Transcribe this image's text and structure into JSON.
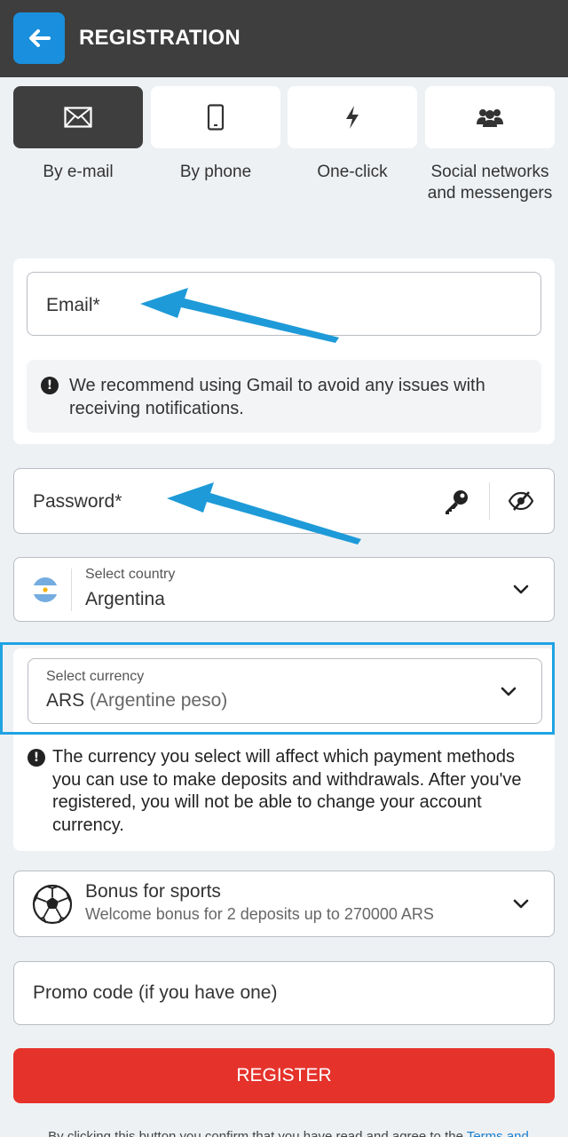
{
  "header": {
    "title": "REGISTRATION",
    "back_icon": "arrow-left-icon"
  },
  "tabs": [
    {
      "label": "By e-mail",
      "icon": "envelope-icon",
      "active": true
    },
    {
      "label": "By phone",
      "icon": "phone-icon",
      "active": false
    },
    {
      "label": "One-click",
      "icon": "lightning-icon",
      "active": false
    },
    {
      "label": "Social networks and messengers",
      "icon": "people-icon",
      "active": false
    }
  ],
  "email": {
    "placeholder": "Email*",
    "notice": "We recommend using Gmail to avoid any issues with receiving notifications."
  },
  "password": {
    "placeholder": "Password*"
  },
  "country": {
    "label": "Select country",
    "value": "Argentina"
  },
  "currency": {
    "label": "Select currency",
    "code": "ARS",
    "name": "(Argentine peso)",
    "notice": "The currency you select will affect which payment methods you can use to make deposits and withdrawals. After you've registered, you will not be able to change your account currency."
  },
  "bonus": {
    "title": "Bonus for sports",
    "subtitle": "Welcome bonus for 2 deposits up to 270000 ARS"
  },
  "promo": {
    "placeholder": "Promo code (if you have one)"
  },
  "register": {
    "label": "REGISTER"
  },
  "footer": {
    "text": "By clicking this button you confirm that you have read and agree to the",
    "link": "Terms and"
  },
  "colors": {
    "accent": "#1a8fdd",
    "header_bg": "#3e3e3e",
    "register_bg": "#e5322b",
    "highlight": "#1fa3e3",
    "annotation_arrow": "#1e9ad8"
  }
}
